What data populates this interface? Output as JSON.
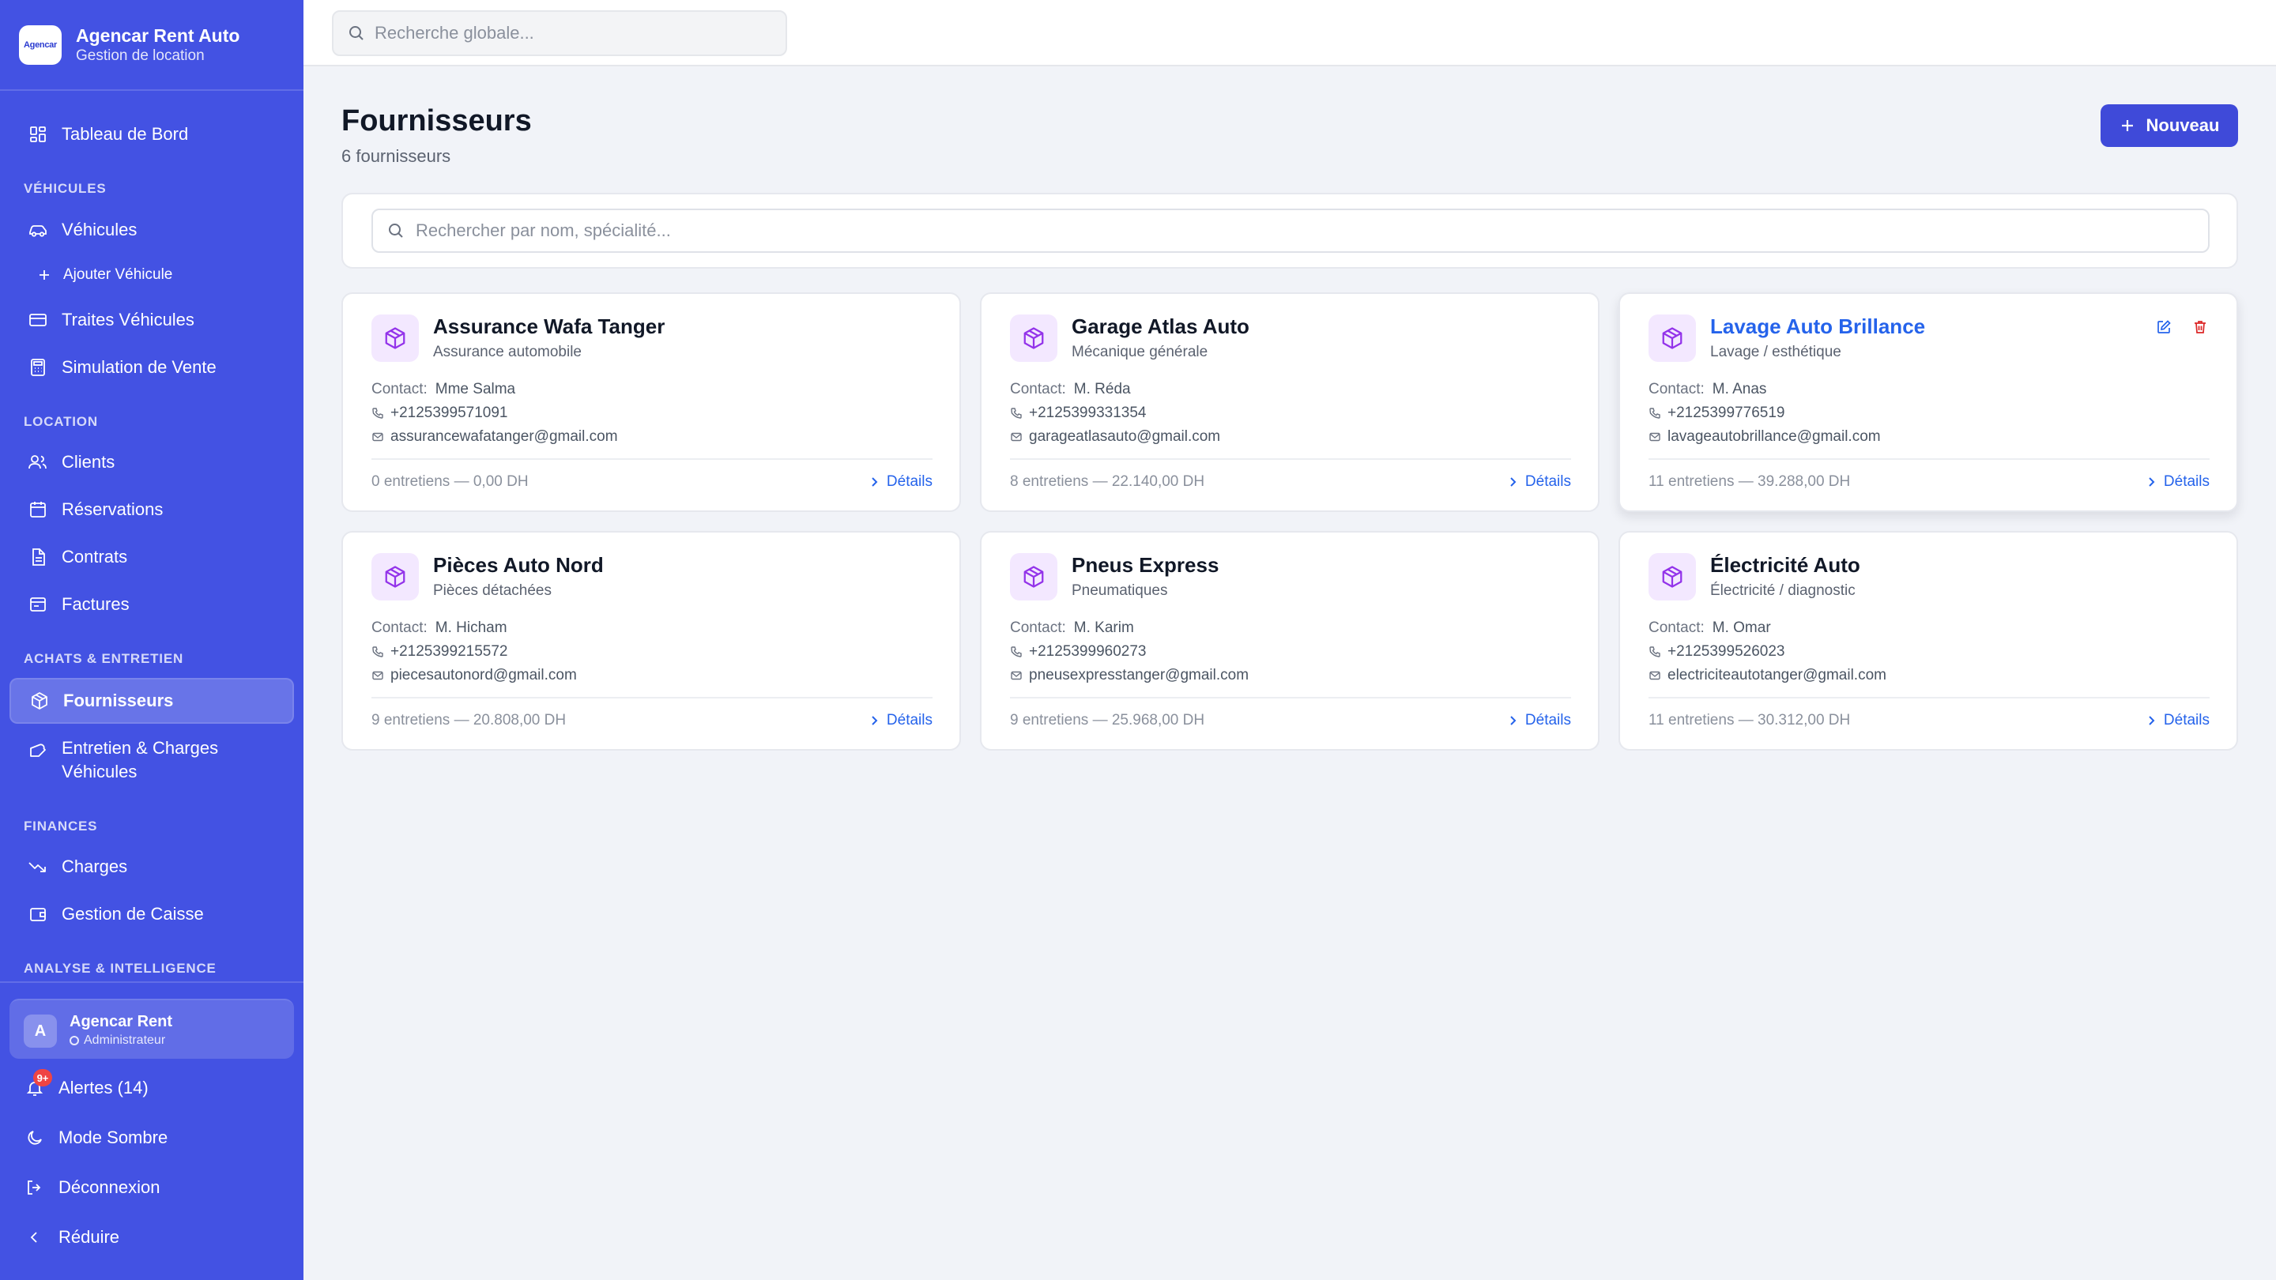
{
  "brand": {
    "logo_text": "Agencar",
    "name": "Agencar Rent Auto",
    "subtitle": "Gestion de location"
  },
  "search": {
    "placeholder": "Recherche globale..."
  },
  "nav": {
    "dashboard": "Tableau de Bord",
    "sections": {
      "vehicules": "VÉHICULES",
      "location": "LOCATION",
      "achats": "ACHATS & ENTRETIEN",
      "finances": "FINANCES",
      "analyse": "ANALYSE & INTELLIGENCE"
    },
    "items": {
      "vehicules": "Véhicules",
      "ajouter": "Ajouter Véhicule",
      "traites": "Traites Véhicules",
      "simulation": "Simulation de Vente",
      "clients": "Clients",
      "reservations": "Réservations",
      "contrats": "Contrats",
      "factures": "Factures",
      "fournisseurs": "Fournisseurs",
      "entretien": "Entretien & Charges Véhicules",
      "charges": "Charges",
      "caisse": "Gestion de Caisse"
    }
  },
  "user": {
    "initial": "A",
    "name": "Agencar Rent",
    "role": "Administrateur"
  },
  "footer": {
    "alerts": "Alertes (14)",
    "alerts_badge": "9+",
    "dark_mode": "Mode Sombre",
    "logout": "Déconnexion",
    "collapse": "Réduire"
  },
  "page": {
    "title": "Fournisseurs",
    "subtitle": "6 fournisseurs",
    "new_button": "Nouveau",
    "filter_placeholder": "Rechercher par nom, spécialité..."
  },
  "labels": {
    "contact": "Contact:",
    "details": "Détails"
  },
  "colors": {
    "sidebar": "#4352e3",
    "accent": "#3f4ad9",
    "link": "#2563eb",
    "icon_bg": "#f3e8ff",
    "icon": "#9333ea",
    "danger": "#dc2626"
  },
  "suppliers": [
    {
      "name": "Assurance Wafa Tanger",
      "specialty": "Assurance automobile",
      "contact": "Mme Salma",
      "phone": "+2125399571091",
      "email": "assurancewafatanger@gmail.com",
      "stats": "0 entretiens — 0,00 DH"
    },
    {
      "name": "Garage Atlas Auto",
      "specialty": "Mécanique générale",
      "contact": "M. Réda",
      "phone": "+2125399331354",
      "email": "garageatlasauto@gmail.com",
      "stats": "8 entretiens — 22.140,00 DH"
    },
    {
      "name": "Lavage Auto Brillance",
      "specialty": "Lavage / esthétique",
      "contact": "M. Anas",
      "phone": "+2125399776519",
      "email": "lavageautobrillance@gmail.com",
      "stats": "11 entretiens — 39.288,00 DH"
    },
    {
      "name": "Pièces Auto Nord",
      "specialty": "Pièces détachées",
      "contact": "M. Hicham",
      "phone": "+2125399215572",
      "email": "piecesautonord@gmail.com",
      "stats": "9 entretiens — 20.808,00 DH"
    },
    {
      "name": "Pneus Express",
      "specialty": "Pneumatiques",
      "contact": "M. Karim",
      "phone": "+2125399960273",
      "email": "pneusexpresstanger@gmail.com",
      "stats": "9 entretiens — 25.968,00 DH"
    },
    {
      "name": "Électricité Auto",
      "specialty": "Électricité / diagnostic",
      "contact": "M. Omar",
      "phone": "+2125399526023",
      "email": "electriciteautotanger@gmail.com",
      "stats": "11 entretiens — 30.312,00 DH"
    }
  ]
}
